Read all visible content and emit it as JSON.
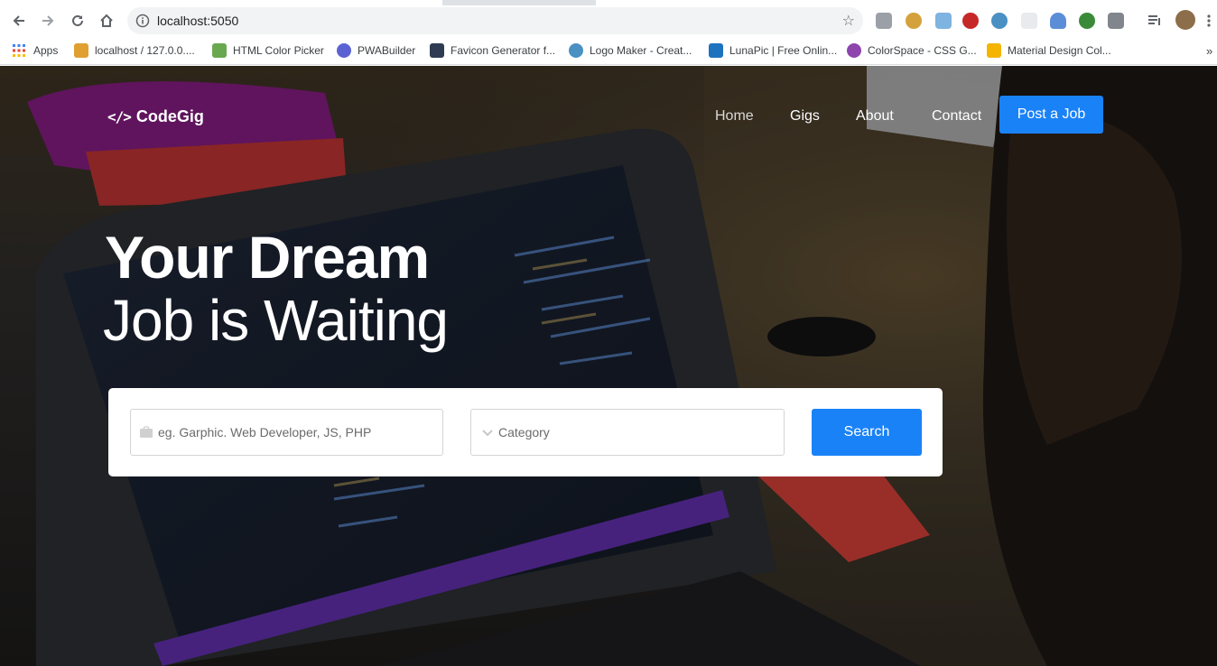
{
  "browser": {
    "url": "localhost:5050",
    "apps_label": "Apps",
    "bookmarks": [
      {
        "label": "localhost / 127.0.0....",
        "icon": "phpmyadmin-icon",
        "color": "#e0a030"
      },
      {
        "label": "HTML Color Picker",
        "icon": "color-picker-icon",
        "color": "#6aa84f"
      },
      {
        "label": "PWABuilder",
        "icon": "pwabuilder-icon",
        "color": "#5b63d3"
      },
      {
        "label": "Favicon Generator f...",
        "icon": "favicon-generator-icon",
        "color": "#2f3b52"
      },
      {
        "label": "Logo Maker - Creat...",
        "icon": "logo-maker-icon",
        "color": "#4a90c2"
      },
      {
        "label": "LunaPic | Free Onlin...",
        "icon": "lunapic-icon",
        "color": "#1e73be"
      },
      {
        "label": "ColorSpace - CSS G...",
        "icon": "colorspace-icon",
        "color": "#8e44ad"
      },
      {
        "label": "Material Design Col...",
        "icon": "material-design-icon",
        "color": "#f4b400"
      }
    ]
  },
  "site": {
    "brand": "CodeGig",
    "nav": [
      "Home",
      "Gigs",
      "About",
      "Contact"
    ],
    "post_job": "Post a Job",
    "headline_bold": "Your Dream",
    "headline_light": "Job is Waiting",
    "search": {
      "keyword_placeholder": "eg. Garphic. Web Developer, JS, PHP",
      "category_placeholder": "Category",
      "button": "Search"
    },
    "accent_color": "#1a82f7"
  }
}
